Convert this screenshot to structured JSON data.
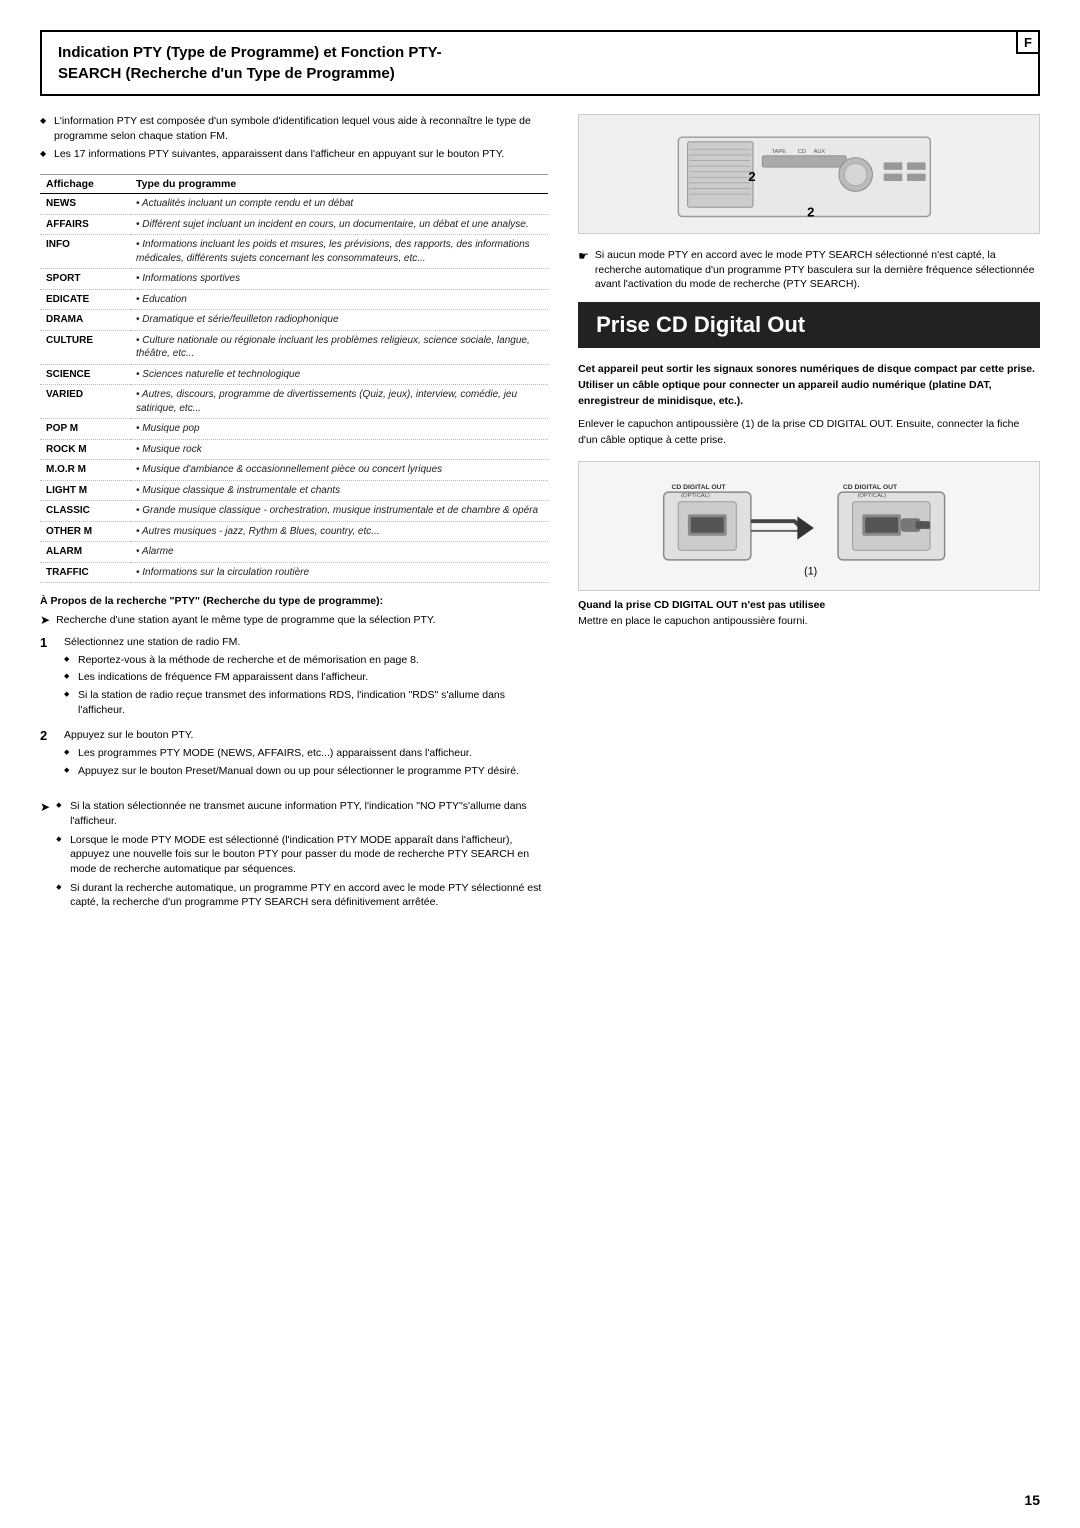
{
  "header": {
    "title_line1": "Indication PTY (Type de Programme) et Fonction PTY-",
    "title_line2": "SEARCH (Recherche d'un Type de Programme)"
  },
  "left_intro_bullets": [
    "L'information PTY est composée d'un symbole d'identification lequel vous aide à reconnaître le type de programme selon chaque station FM.",
    "Les 17 informations PTY suivantes, apparaissent dans l'afficheur en appuyant sur le bouton PTY."
  ],
  "table": {
    "col1_header": "Affichage",
    "col2_header": "Type du programme",
    "rows": [
      {
        "name": "NEWS",
        "desc": "• Actualités incluant un compte rendu et un débat"
      },
      {
        "name": "AFFAIRS",
        "desc": "• Différent sujet incluant un incident en cours, un documentaire, un débat et une analyse."
      },
      {
        "name": "INFO",
        "desc": "• Informations incluant les poids et msures, les prévisions, des rapports, des informations médicales, différents sujets concernant les consommateurs, etc..."
      },
      {
        "name": "SPORT",
        "desc": "• Informations sportives"
      },
      {
        "name": "EDICATE",
        "desc": "• Education"
      },
      {
        "name": "DRAMA",
        "desc": "• Dramatique et série/feuilleton radiophonique"
      },
      {
        "name": "CULTURE",
        "desc": "• Culture nationale ou régionale incluant les problèmes religieux, science sociale, langue, théâtre, etc..."
      },
      {
        "name": "SCIENCE",
        "desc": "• Sciences naturelle et technologique"
      },
      {
        "name": "VARIED",
        "desc": "• Autres, discours, programme de divertissements (Quiz, jeux), interview, comédie, jeu satirique, etc..."
      },
      {
        "name": "POP M",
        "desc": "• Musique pop"
      },
      {
        "name": "ROCK M",
        "desc": "• Musique rock"
      },
      {
        "name": "M.O.R M",
        "desc": "• Musique d'ambiance & occasionnellement pièce ou concert lyriques"
      },
      {
        "name": "LIGHT M",
        "desc": "• Musique classique & instrumentale et chants"
      },
      {
        "name": "CLASSIC",
        "desc": "• Grande musique classique - orchestration, musique instrumentale et de chambre & opéra"
      },
      {
        "name": "OTHER M",
        "desc": "• Autres musiques - jazz, Rythm & Blues, country, etc..."
      },
      {
        "name": "ALARM",
        "desc": "• Alarme"
      },
      {
        "name": "TRAFFIC",
        "desc": "• Informations sur la circulation routière"
      }
    ]
  },
  "pty_search_heading": "À Propos de la recherche \"PTY\" (Recherche du type de programme):",
  "pty_search_arrow": "Recherche d'une station ayant le même type de programme que la sélection PTY.",
  "steps": [
    {
      "num": "1",
      "main": "Sélectionnez une station de radio FM.",
      "sub_bullets": [
        "Reportez-vous à la méthode de recherche et de mémorisation en page 8.",
        "Les indications de fréquence FM apparaissent dans l'afficheur.",
        "Si la station de radio reçue transmet des informations RDS, l'indication \"RDS\" s'allume dans l'afficheur."
      ]
    },
    {
      "num": "2",
      "main": "Appuyez sur le bouton PTY.",
      "sub_bullets": [
        "Les programmes PTY MODE (NEWS, AFFAIRS, etc...) apparaissent dans l'afficheur.",
        "Appuyez sur le bouton Preset/Manual down ou up pour sélectionner le programme PTY désiré."
      ]
    }
  ],
  "bottom_arrow_bullets": [
    "Si la station sélectionnée ne transmet aucune information PTY, l'indication \"NO PTY\"s'allume dans l'afficheur.",
    "Lorsque le mode PTY MODE est sélectionné (l'indication PTY MODE apparaît dans l'afficheur), appuyez une nouvelle fois sur le bouton PTY pour passer du mode de recherche PTY SEARCH en mode de recherche automatique par séquences.",
    "Si durant la recherche automatique, un programme PTY en accord avec le mode PTY sélectionné est capté, la recherche d'un programme PTY SEARCH sera définitivement arrêtée."
  ],
  "right_col": {
    "note": "Si aucun mode PTY en accord avec le mode PTY SEARCH sélectionné n'est capté, la recherche automatique d'un programme PTY basculera sur la dernière fréquence sélectionnée avant l'activation du mode de recherche (PTY SEARCH).",
    "prise_title": "Prise CD Digital Out",
    "prise_para1": "Cet appareil peut sortir les signaux sonores numériques de disque compact par cette prise. Utiliser un câble optique pour connecter un appareil audio numérique (platine DAT, enregistreur de minidisque, etc.).",
    "prise_para2": "Enlever le capuchon antipoussière (1) de la prise CD DIGITAL OUT. Ensuite, connecter la fiche d'un câble optique à cette prise.",
    "quand_caption": "Quand la prise CD DIGITAL OUT n'est pas utilisee",
    "quand_sub": "Mettre en place le capuchon antipoussière fourni."
  },
  "page_number": "15",
  "f_badge": "F"
}
